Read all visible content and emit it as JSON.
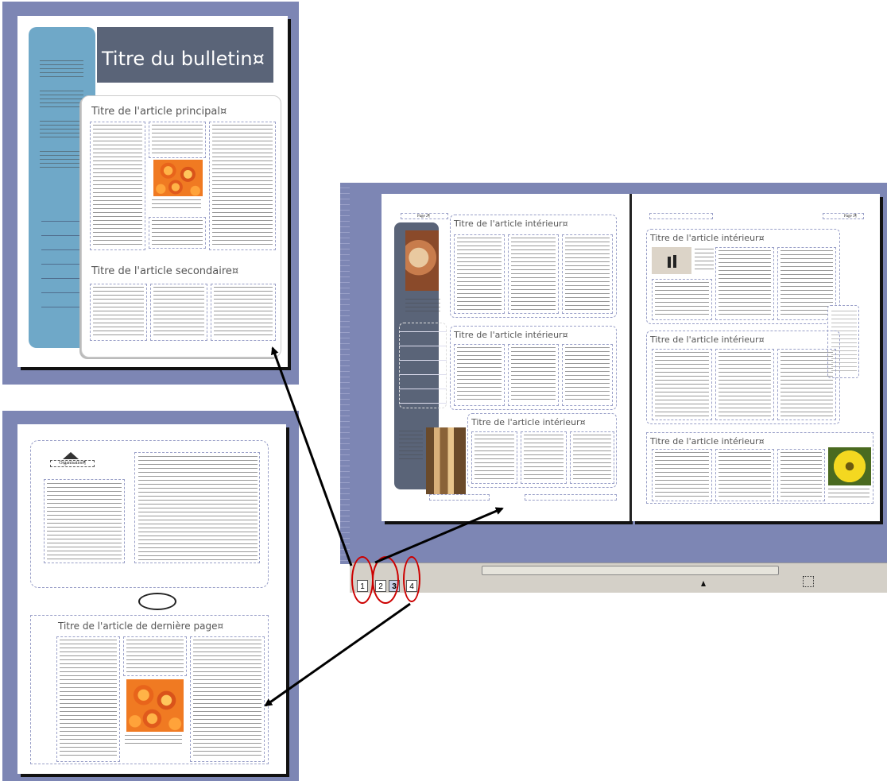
{
  "page1": {
    "title": "Titre du bulletin¤",
    "main_article": "Titre de l'article principal¤",
    "secondary_article": "Titre de l'article secondaire¤",
    "caption": "Légende accompagnant l'illustration. ¶"
  },
  "spread": {
    "left_page_label": "Page 2¶",
    "right_page_label": "Page 3¶",
    "article_titles": [
      "Titre de l'article intérieur¤",
      "Titre de l'article intérieur¤",
      "Titre de l'article intérieur¤",
      "Titre de l'article intérieur¤",
      "Titre de l'article intérieur¤",
      "Titre de l'article intérieur¤"
    ]
  },
  "page4": {
    "org_name": "Organisation¶",
    "article_title": "Titre de l'article de dernière page¤",
    "caption": "Légende accompagnant l'illustration. ¶"
  },
  "page_tabs": [
    "1",
    "2",
    "3",
    "4"
  ],
  "colors": {
    "window_bg": "#7d86b4",
    "highlight_oval": "#cc0000",
    "sidebar_blue": "#6fa8c8",
    "title_bar": "#5a6478"
  }
}
